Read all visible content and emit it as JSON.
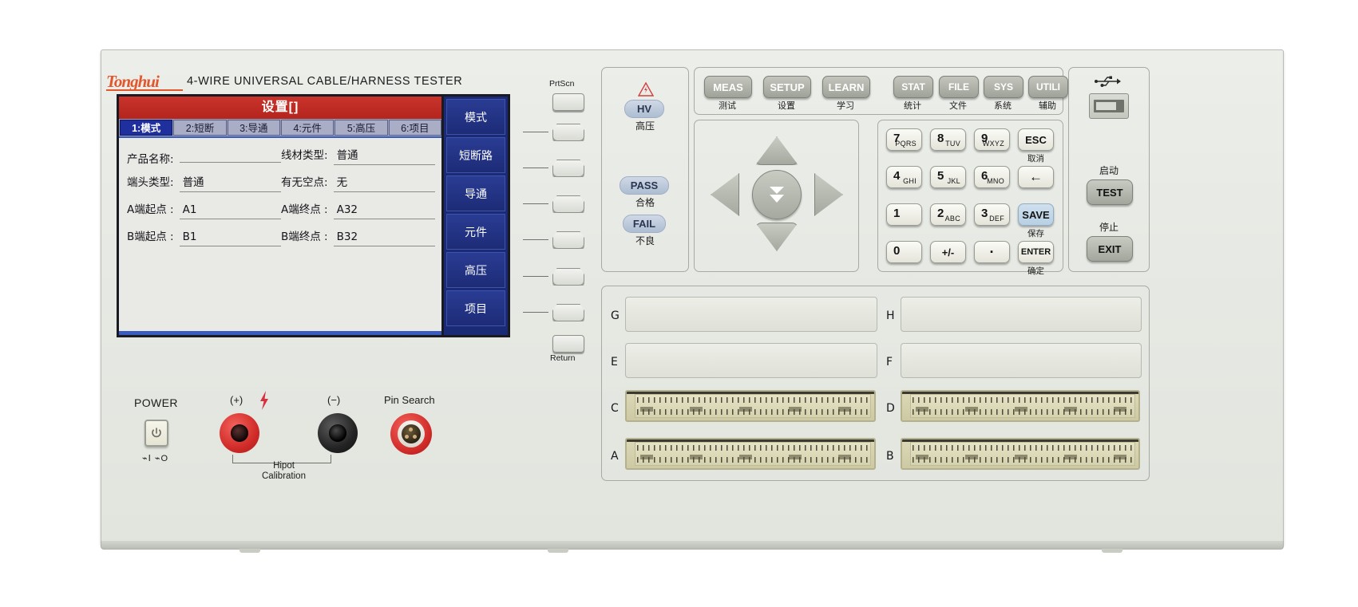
{
  "device": {
    "brand": "Tonghui",
    "model_title": "4-WIRE  UNIVERSAL  CABLE/HARNESS  TESTER"
  },
  "lcd": {
    "title": "设置[]",
    "tabs": [
      {
        "label": "1:模式",
        "active": true
      },
      {
        "label": "2:短断",
        "active": false
      },
      {
        "label": "3:导通",
        "active": false
      },
      {
        "label": "4:元件",
        "active": false
      },
      {
        "label": "5:高压",
        "active": false
      },
      {
        "label": "6:项目",
        "active": false
      }
    ],
    "fields": [
      {
        "label": "产品名称:",
        "value": ""
      },
      {
        "label": "线材类型:",
        "value": "普通"
      },
      {
        "label": "端头类型:",
        "value": "普通"
      },
      {
        "label": "有无空点:",
        "value": "无"
      },
      {
        "label": "A端起点 :",
        "value": "A1"
      },
      {
        "label": "A端终点 :",
        "value": "A32"
      },
      {
        "label": "B端起点 :",
        "value": "B1"
      },
      {
        "label": "B端终点 :",
        "value": "B32"
      }
    ]
  },
  "soft_menu": {
    "items": [
      {
        "label": "模式"
      },
      {
        "label": "短断路"
      },
      {
        "label": "导通"
      },
      {
        "label": "元件"
      },
      {
        "label": "高压"
      },
      {
        "label": "项目"
      }
    ]
  },
  "soft_buttons": {
    "top_label": "PrtScn",
    "bottom_label": "Return"
  },
  "indicators": {
    "warning_icon": "high-voltage-warning-icon",
    "items": [
      {
        "led": "HV",
        "label": "高压"
      },
      {
        "led": "PASS",
        "label": "合格"
      },
      {
        "led": "FAIL",
        "label": "不良"
      }
    ]
  },
  "function_keys": [
    {
      "key": "MEAS",
      "sub": "测试"
    },
    {
      "key": "SETUP",
      "sub": "设置"
    },
    {
      "key": "LEARN",
      "sub": "学习"
    },
    {
      "key": "STAT",
      "sub": "统计"
    },
    {
      "key": "FILE",
      "sub": "文件"
    },
    {
      "key": "SYS",
      "sub": "系统"
    },
    {
      "key": "UTILI",
      "sub": "辅助"
    }
  ],
  "arrow_pad": {
    "up": "arrow-up-icon",
    "down": "arrow-down-icon",
    "left": "arrow-left-icon",
    "right": "arrow-right-icon",
    "center": "double-chevron-down-icon"
  },
  "keypad": {
    "keys": [
      {
        "big": "7",
        "small": "PQRS"
      },
      {
        "big": "8",
        "small": "TUV"
      },
      {
        "big": "9",
        "small": "WXYZ"
      },
      {
        "center": "ESC",
        "sub": "取消"
      },
      {
        "big": "4",
        "small": "GHI"
      },
      {
        "big": "5",
        "small": "JKL"
      },
      {
        "big": "6",
        "small": "MNO"
      },
      {
        "center": "←",
        "sub": ""
      },
      {
        "big": "1",
        "small": ""
      },
      {
        "big": "2",
        "small": "ABC"
      },
      {
        "big": "3",
        "small": "DEF"
      },
      {
        "center": "SAVE",
        "sub": "保存",
        "highlight": true
      },
      {
        "big": "0",
        "small": ""
      },
      {
        "center": "+/-",
        "sub": ""
      },
      {
        "center": "·",
        "sub": ""
      },
      {
        "center": "ENTER",
        "sub": "确定"
      }
    ]
  },
  "right_panel": {
    "usb_icon": "usb-icon",
    "start_label": "启动",
    "test_button": "TEST",
    "stop_label": "停止",
    "exit_button": "EXIT"
  },
  "connectors": {
    "left_labels": [
      "G",
      "E",
      "C",
      "A"
    ],
    "right_labels": [
      "H",
      "F",
      "D",
      "B"
    ]
  },
  "bottom_controls": {
    "power_label": "POWER",
    "power_icon": "power-icon",
    "power_marks": "⌁Ⅰ ⌁O",
    "plus_label": "(+)",
    "minus_label": "(−)",
    "hv_bolt_icon": "lightning-bolt-icon",
    "hipot_line1": "Hipot",
    "hipot_line2": "Calibration",
    "pin_search_label": "Pin Search"
  },
  "colors": {
    "panel": "#e7e9e4",
    "lcd_title_red": "#c3302a",
    "lcd_menu_blue": "#1b2a74",
    "accent_orange": "#e2572c",
    "save_blue": "#c6daea",
    "terminal_red": "#cf2a27",
    "terminal_black": "#232323"
  }
}
